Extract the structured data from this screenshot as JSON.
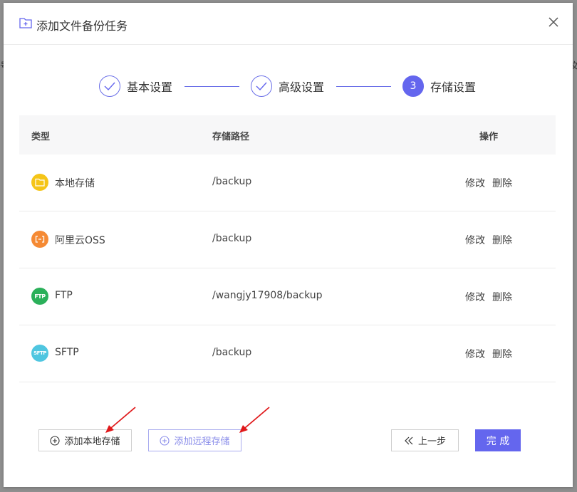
{
  "dialog": {
    "title": "添加文件备份任务"
  },
  "steps": [
    {
      "label": "基本设置",
      "status": "done"
    },
    {
      "label": "高级设置",
      "status": "done"
    },
    {
      "label": "存储设置",
      "status": "active",
      "number": "3"
    }
  ],
  "table": {
    "headers": {
      "type": "类型",
      "path": "存储路径",
      "actions": "操作"
    },
    "rows": [
      {
        "type": "本地存储",
        "icon": "folder-icon",
        "icon_color": "#f5c518",
        "path": "/backup",
        "edit": "修改",
        "delete": "删除"
      },
      {
        "type": "阿里云OSS",
        "icon": "aliyun-icon",
        "icon_color": "#f58a34",
        "path": "/backup",
        "edit": "修改",
        "delete": "删除"
      },
      {
        "type": "FTP",
        "icon": "ftp-icon",
        "icon_color": "#2bb05a",
        "icon_text": "FTP",
        "path": "/wangjy17908/backup",
        "edit": "修改",
        "delete": "删除"
      },
      {
        "type": "SFTP",
        "icon": "sftp-icon",
        "icon_color": "#4fc6e0",
        "icon_text": "SFTP",
        "path": "/backup",
        "edit": "修改",
        "delete": "删除"
      }
    ]
  },
  "buttons": {
    "add_local": "添加本地存储",
    "add_remote": "添加远程存储",
    "prev": "上一步",
    "finish": "完 成"
  },
  "colors": {
    "accent": "#6466ee",
    "annotation_arrow": "#e0191b"
  }
}
